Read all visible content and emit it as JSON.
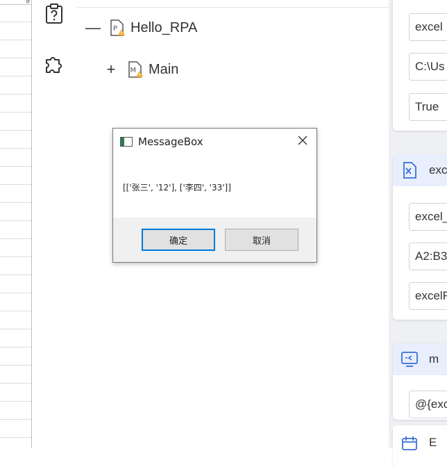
{
  "spreadsheet": {
    "top_glyph": "g"
  },
  "sidebar": {
    "icons": [
      "clipboard-question-icon",
      "puzzle-icon"
    ]
  },
  "tree": {
    "root": {
      "toggle": "—",
      "label": "Hello_RPA",
      "icon": "python-file-warning-icon"
    },
    "child": {
      "toggle": "+",
      "label": "Main",
      "icon": "main-file-warning-icon"
    }
  },
  "properties": {
    "card1": {
      "fields": [
        "excel",
        "C:\\Us",
        "True"
      ]
    },
    "card2": {
      "header": "exc",
      "icon": "excel-x-icon",
      "fields": [
        "excel_",
        "A2:B3",
        "excelF"
      ]
    },
    "card3": {
      "header": "m",
      "icon": "monitor-message-icon",
      "fields": [
        "@{exc"
      ]
    },
    "card4": {
      "header": "E",
      "icon": "calendar-icon"
    }
  },
  "colors": {
    "accent": "#0078d7",
    "header_bg": "#e8eefc",
    "icon_blue": "#3b6fd8",
    "warning": "#f5a623"
  },
  "messagebox": {
    "title": "MessageBox",
    "content": "[['张三', '12'], ['李四', '33']]",
    "ok_label": "确定",
    "cancel_label": "取消"
  }
}
